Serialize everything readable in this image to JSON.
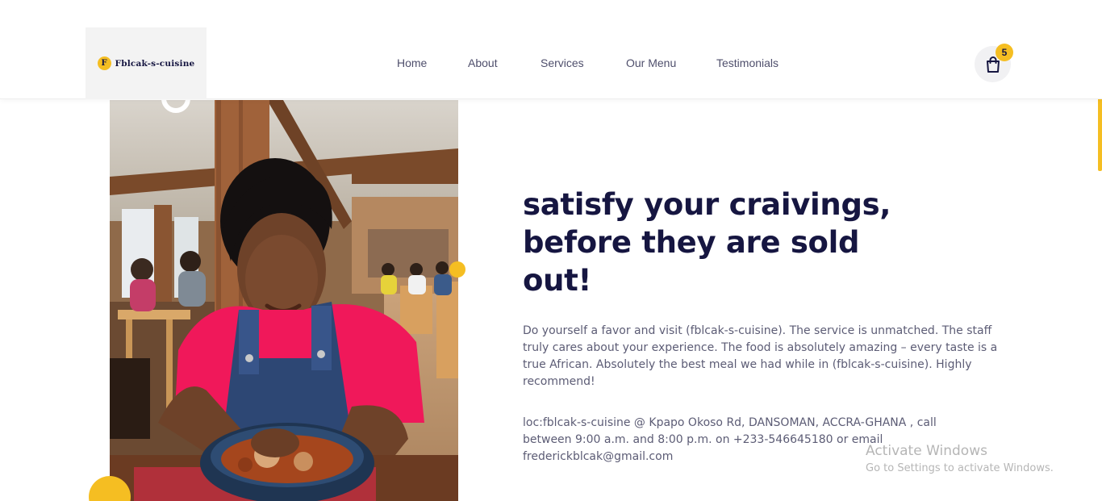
{
  "brand": {
    "logo_letter": "F",
    "name": "Fblcak-s-cuisine"
  },
  "nav": {
    "items": [
      "Home",
      "About",
      "Services",
      "Our Menu",
      "Testimonials"
    ]
  },
  "cart": {
    "count": "5"
  },
  "hero": {
    "headline": "satisfy your craivings, before they are sold out!",
    "description": "Do yourself a favor and visit (fblcak-s-cuisine). The service is unmatched. The staff truly cares about your experience. The food is absolutely amazing – every taste is a true African. Absolutely the best meal we had while in (fblcak-s-cuisine). Highly recommend!",
    "location": "loc:fblcak-s-cuisine @ Kpapo Okoso Rd, DANSOMAN, ACCRA-GHANA , call between 9:00 a.m. and 8:00 p.m. on +233-546645180 or email frederickblcak@gmail.com"
  },
  "watermark": {
    "title": "Activate Windows",
    "subtitle": "Go to Settings to activate Windows."
  },
  "colors": {
    "accent": "#f5be22",
    "heading": "#161641",
    "body_text": "#5c5c75"
  },
  "icons": [
    "shopping-bag-icon"
  ]
}
